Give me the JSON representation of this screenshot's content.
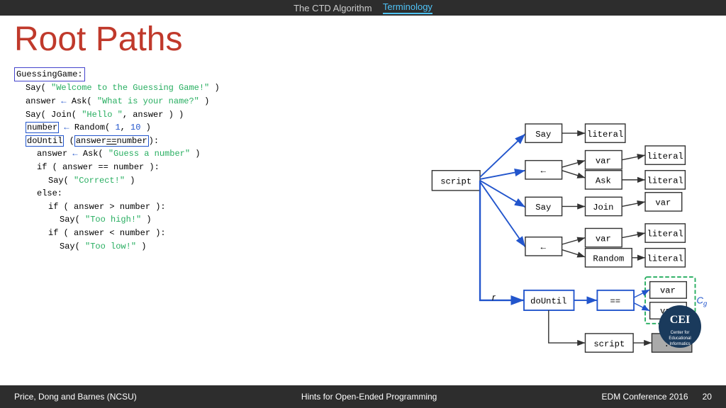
{
  "topbar": {
    "inactive_tab": "The CTD Algorithm",
    "active_tab": "Terminology"
  },
  "page": {
    "title": "Root Paths"
  },
  "code": {
    "lines": [
      {
        "indent": 0,
        "content": "GuessingGame:"
      },
      {
        "indent": 1,
        "content": "Say( \"Welcome to the Guessing Game!\" )"
      },
      {
        "indent": 1,
        "content": "answer ← Ask( \"What is your name?\" )"
      },
      {
        "indent": 1,
        "content": "Say( Join( \"Hello \", answer ) )"
      },
      {
        "indent": 1,
        "content": "number ← Random( 1, 10 )"
      },
      {
        "indent": 1,
        "content": "doUntil ( answer == number ):"
      },
      {
        "indent": 2,
        "content": "answer ← Ask( \"Guess a number\" )"
      },
      {
        "indent": 2,
        "content": "if ( answer == number ):"
      },
      {
        "indent": 3,
        "content": "Say( \"Correct!\" )"
      },
      {
        "indent": 2,
        "content": "else:"
      },
      {
        "indent": 3,
        "content": "if ( answer > number ):"
      },
      {
        "indent": 4,
        "content": "Say( \"Too high!\" )"
      },
      {
        "indent": 3,
        "content": "if ( answer < number ):"
      },
      {
        "indent": 4,
        "content": "Say( \"Too low!\" )"
      }
    ]
  },
  "diagram": {
    "script_label": "script",
    "say_label": "Say",
    "literal_label": "literal",
    "var_label": "var",
    "ask_label": "Ask",
    "join_label": "Join",
    "random_label": "Random",
    "dountil_label": "doUntil",
    "eq_label": "==",
    "ellipsis_label": "...",
    "r_label": "r",
    "cg_label": "Cg"
  },
  "bottombar": {
    "left": "Price, Dong and Barnes (NCSU)",
    "center": "Hints for Open-Ended Programming",
    "right": "EDM Conference 2016",
    "page_num": "20"
  }
}
